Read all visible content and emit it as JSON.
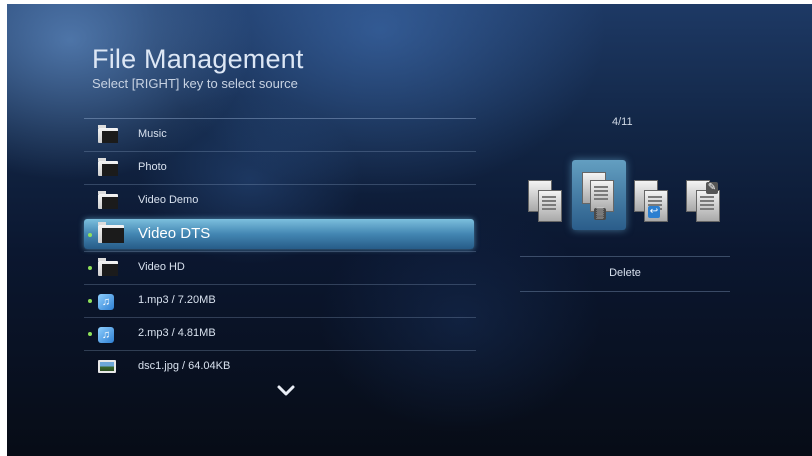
{
  "header": {
    "title": "File Management",
    "subtitle": "Select [RIGHT] key to select source"
  },
  "file_list": {
    "items": [
      {
        "label": "Music",
        "icon": "folder-icon",
        "marked": false,
        "selected": false
      },
      {
        "label": "Photo",
        "icon": "folder-icon",
        "marked": false,
        "selected": false
      },
      {
        "label": "Video Demo",
        "icon": "folder-icon",
        "marked": false,
        "selected": false
      },
      {
        "label": "Video DTS",
        "icon": "folder-icon",
        "marked": true,
        "selected": true
      },
      {
        "label": "Video HD",
        "icon": "folder-icon",
        "marked": true,
        "selected": false
      },
      {
        "label": "1.mp3 / 7.20MB",
        "icon": "music-file-icon",
        "marked": true,
        "selected": false
      },
      {
        "label": "2.mp3 / 4.81MB",
        "icon": "music-file-icon",
        "marked": true,
        "selected": false
      },
      {
        "label": "dsc1.jpg / 64.04KB",
        "icon": "image-file-icon",
        "marked": false,
        "selected": false
      }
    ],
    "more_icon": "chevron-down-icon"
  },
  "actions": {
    "counter": "4/11",
    "items": [
      {
        "name": "copy",
        "icon": "copy-icon",
        "selected": false
      },
      {
        "name": "delete",
        "icon": "delete-icon",
        "selected": true
      },
      {
        "name": "move",
        "icon": "move-icon",
        "selected": false
      },
      {
        "name": "rename",
        "icon": "rename-icon",
        "selected": false
      }
    ],
    "selected_label": "Delete"
  },
  "colors": {
    "marker": "#8fe05a",
    "highlight": "#5aa7d6",
    "background": "#0b1730"
  }
}
